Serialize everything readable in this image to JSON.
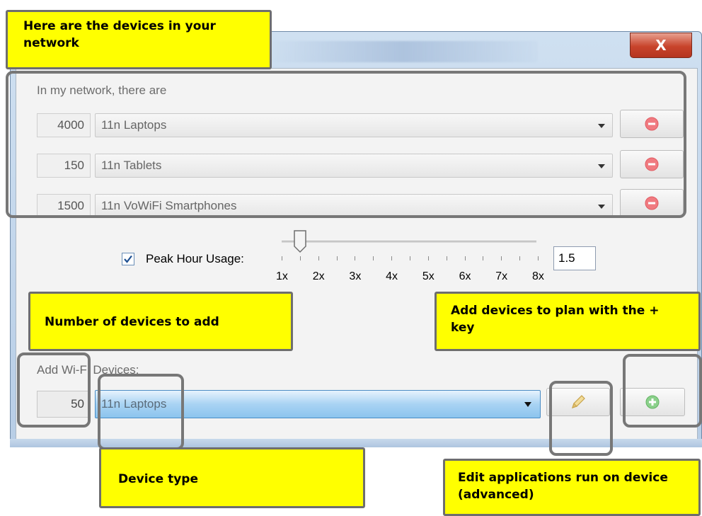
{
  "window": {
    "close_label": "X"
  },
  "network": {
    "label": "In my network, there are",
    "rows": [
      {
        "count": "4000",
        "device": "11n Laptops"
      },
      {
        "count": "150",
        "device": "11n Tablets"
      },
      {
        "count": "1500",
        "device": "11n VoWiFi Smartphones"
      }
    ]
  },
  "peak_hour": {
    "checked": true,
    "label": "Peak Hour Usage:",
    "value": "1.5",
    "ticks": [
      "1x",
      "2x",
      "3x",
      "4x",
      "5x",
      "6x",
      "7x",
      "8x"
    ],
    "slider_value": 1.5,
    "slider_min": 1,
    "slider_max": 8
  },
  "add_devices": {
    "label": "Add Wi-Fi Devices:",
    "count": "50",
    "device": "11n Laptops"
  },
  "callouts": {
    "network_devices": "Here are the devices in your network",
    "number_to_add": "Number of devices to add",
    "add_with_plus": "Add devices to plan with the + key",
    "device_type": "Device type",
    "edit_apps": "Edit applications  run on device (advanced)"
  },
  "colors": {
    "callout_bg": "#ffff00",
    "remove_icon": "#f07a80",
    "add_icon": "#8bd08b"
  }
}
